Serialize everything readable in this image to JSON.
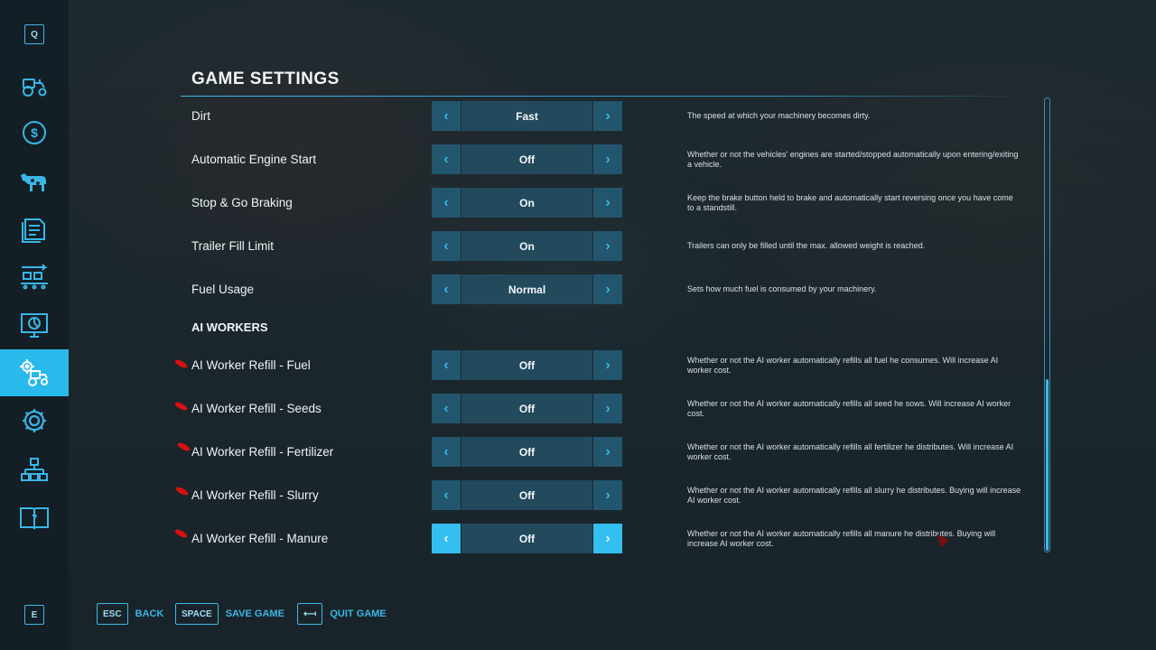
{
  "sidebar": {
    "top_key": "Q",
    "bottom_key": "E",
    "items": [
      {
        "name": "vehicles",
        "icon": "tractor-icon"
      },
      {
        "name": "finances",
        "icon": "dollar-icon"
      },
      {
        "name": "animals",
        "icon": "cow-icon"
      },
      {
        "name": "contracts",
        "icon": "contracts-icon"
      },
      {
        "name": "production",
        "icon": "production-icon"
      },
      {
        "name": "statistics",
        "icon": "statistics-icon"
      },
      {
        "name": "game-settings",
        "icon": "settings-tractor-icon",
        "active": true
      },
      {
        "name": "general-settings",
        "icon": "gear-icon"
      },
      {
        "name": "hierarchy",
        "icon": "hierarchy-icon"
      },
      {
        "name": "help",
        "icon": "help-book-icon"
      }
    ]
  },
  "header": {
    "title": "GAME SETTINGS"
  },
  "settings": [
    {
      "label": "Dirt",
      "value": "Fast",
      "desc": "The speed at which your machinery becomes dirty."
    },
    {
      "label": "Automatic Engine Start",
      "value": "Off",
      "desc": "Whether or not the vehicles' engines are started/stopped automatically upon entering/exiting a vehicle."
    },
    {
      "label": "Stop & Go Braking",
      "value": "On",
      "desc": "Keep the brake button held to brake and automatically start reversing once you have come to a standstill."
    },
    {
      "label": "Trailer Fill Limit",
      "value": "On",
      "desc": "Trailers can only be filled until the max. allowed weight is reached."
    },
    {
      "label": "Fuel Usage",
      "value": "Normal",
      "desc": "Sets how much fuel is consumed by your machinery."
    }
  ],
  "ai_section": {
    "title": "AI WORKERS",
    "settings": [
      {
        "label": "AI Worker Refill - Fuel",
        "value": "Off",
        "desc": "Whether or not the AI worker automatically refills all fuel he consumes. Will increase AI worker cost."
      },
      {
        "label": "AI Worker Refill - Seeds",
        "value": "Off",
        "desc": "Whether or not the AI worker automatically refills all seed he sows. Will increase AI worker cost."
      },
      {
        "label": "AI Worker Refill - Fertilizer",
        "value": "Off",
        "desc": "Whether or not the AI worker automatically refills all fertilizer he distributes. Will increase AI worker cost."
      },
      {
        "label": "AI Worker Refill - Slurry",
        "value": "Off",
        "desc": "Whether or not the AI worker automatically refills all slurry he distributes. Buying will increase AI worker cost."
      },
      {
        "label": "AI Worker Refill - Manure",
        "value": "Off",
        "desc": "Whether or not the AI worker automatically refills all manure he distributes. Buying will increase AI worker cost."
      }
    ]
  },
  "bottom_bar": {
    "back": {
      "key": "ESC",
      "label": "BACK"
    },
    "save": {
      "key": "SPACE",
      "label": "SAVE GAME"
    },
    "quit": {
      "key": "⟻",
      "label": "QUIT GAME"
    }
  },
  "colors": {
    "accent": "#29b9ea",
    "arrow_bg": "#22566e",
    "value_bg": "#224a5c",
    "annotation": "#d81010"
  }
}
